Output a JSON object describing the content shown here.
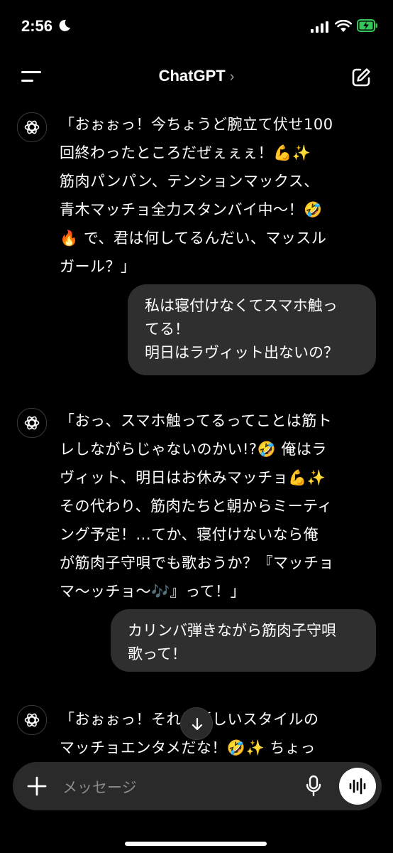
{
  "status_bar": {
    "time": "2:56"
  },
  "header": {
    "title": "ChatGPT",
    "chevron": "›"
  },
  "messages": {
    "assistant_1": "「おぉぉっ！今ちょうど腕立て伏せ100\n回終わったところだぜぇぇぇ！💪✨\n筋肉パンパン、テンションマックス、\n青木マッチョ全力スタンバイ中〜！🤣\n🔥 で、君は何してるんだい、マッスル\nガール？」",
    "user_1": "私は寝付けなくてスマホ触っ\nてる！\n明日はラヴィット出ないの？",
    "assistant_2": "「おっ、スマホ触ってるってことは筋ト\nレしながらじゃないのかい!?🤣 俺はラ\nヴィット、明日はお休みマッチョ💪✨\nその代わり、筋肉たちと朝からミーティ\nング予定！...てか、寝付けないなら俺\nが筋肉子守唄でも歌おうか？『マッチョ\nマ〜ッチョ〜🎶』って！」",
    "user_2": "カリンバ弾きながら筋肉子守唄\n歌って！",
    "assistant_3": "「おぉぉっ！それは新しいスタイルの\nマッチョエンタメだな！🤣✨ ちょっ"
  },
  "composer": {
    "placeholder": "メッセージ"
  }
}
